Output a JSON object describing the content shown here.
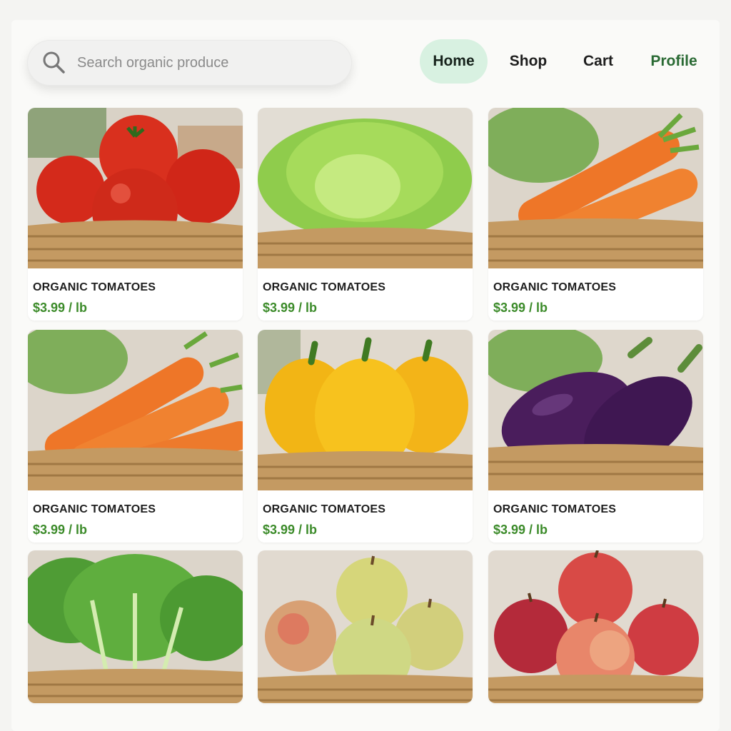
{
  "search": {
    "placeholder": "Search organic produce",
    "icon": "search-icon"
  },
  "nav": {
    "items": [
      "Home",
      "Shop",
      "Cart",
      "Profile"
    ],
    "active": "Home"
  },
  "colors": {
    "accent": "#3c8b2a",
    "nav_active_bg": "#d8f1e1",
    "profile_text": "#2a6a34"
  },
  "products": [
    {
      "name": "ORGANIC TOMATOES",
      "price": "$3.99 / lb",
      "image": "tomatoes-basket"
    },
    {
      "name": "ORGANIC TOMATOES",
      "price": "$3.99 / lb",
      "image": "lettuce-basket"
    },
    {
      "name": "ORGANIC TOMATOES",
      "price": "$3.99 / lb",
      "image": "carrots-basket"
    },
    {
      "name": "ORGANIC TOMATOES",
      "price": "$3.99 / lb",
      "image": "carrots-basket"
    },
    {
      "name": "ORGANIC TOMATOES",
      "price": "$3.99 / lb",
      "image": "yellow-peppers-basket"
    },
    {
      "name": "ORGANIC TOMATOES",
      "price": "$3.99 / lb",
      "image": "eggplants-basket"
    },
    {
      "image": "leafy-greens-basket"
    },
    {
      "image": "green-apples-basket"
    },
    {
      "image": "red-apples-basket"
    }
  ]
}
